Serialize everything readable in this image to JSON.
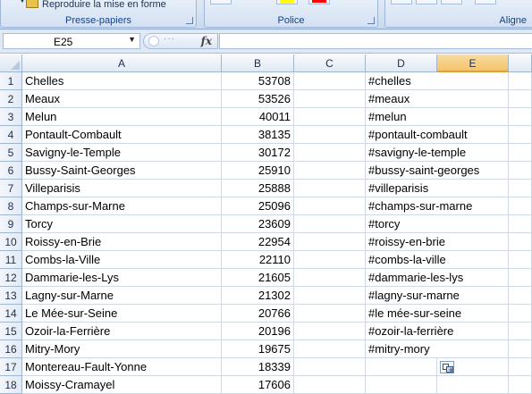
{
  "ribbon": {
    "clipboard_group": {
      "label": "Presse-papiers",
      "brush_label": "Reproduire la mise en forme"
    },
    "font_group": {
      "label": "Police",
      "highlight_color": "#ffff00",
      "font_color": "#ff0000"
    },
    "alignment_group": {
      "label": "Aligne"
    }
  },
  "formula_bar": {
    "name_box": "E25",
    "fx_label": "fx",
    "formula": ""
  },
  "sheet": {
    "columns": [
      "A",
      "B",
      "C",
      "D",
      "E"
    ],
    "active_column": "E",
    "rows": [
      {
        "n": "1",
        "a": "Chelles",
        "b": "53708",
        "d": "#chelles"
      },
      {
        "n": "2",
        "a": "Meaux",
        "b": "53526",
        "d": "#meaux"
      },
      {
        "n": "3",
        "a": "Melun",
        "b": "40011",
        "d": "#melun"
      },
      {
        "n": "4",
        "a": "Pontault-Combault",
        "b": "38135",
        "d": "#pontault-combault"
      },
      {
        "n": "5",
        "a": "Savigny-le-Temple",
        "b": "30172",
        "d": "#savigny-le-temple"
      },
      {
        "n": "6",
        "a": "Bussy-Saint-Georges",
        "b": "25910",
        "d": "#bussy-saint-georges"
      },
      {
        "n": "7",
        "a": "Villeparisis",
        "b": "25888",
        "d": "#villeparisis"
      },
      {
        "n": "8",
        "a": "Champs-sur-Marne",
        "b": "25096",
        "d": "#champs-sur-marne"
      },
      {
        "n": "9",
        "a": "Torcy",
        "b": "23609",
        "d": "#torcy"
      },
      {
        "n": "10",
        "a": "Roissy-en-Brie",
        "b": "22954",
        "d": "#roissy-en-brie"
      },
      {
        "n": "11",
        "a": "Combs-la-Ville",
        "b": "22110",
        "d": "#combs-la-ville"
      },
      {
        "n": "12",
        "a": "Dammarie-les-Lys",
        "b": "21605",
        "d": "#dammarie-les-lys"
      },
      {
        "n": "13",
        "a": "Lagny-sur-Marne",
        "b": "21302",
        "d": "#lagny-sur-marne"
      },
      {
        "n": "14",
        "a": "Le Mée-sur-Seine",
        "b": "20766",
        "d": "#le mée-sur-seine"
      },
      {
        "n": "15",
        "a": "Ozoir-la-Ferrière",
        "b": "20196",
        "d": "#ozoir-la-ferrière"
      },
      {
        "n": "16",
        "a": "Mitry-Mory",
        "b": "19675",
        "d": "#mitry-mory"
      },
      {
        "n": "17",
        "a": "Montereau-Fault-Yonne",
        "b": "18339",
        "d": ""
      },
      {
        "n": "18",
        "a": "Moissy-Cramayel",
        "b": "17606",
        "d": ""
      }
    ]
  },
  "icons": {
    "paste_options": "paste-options-icon",
    "format_painter": "format-painter-icon",
    "name_box_dropdown": "chevron-down-icon"
  }
}
